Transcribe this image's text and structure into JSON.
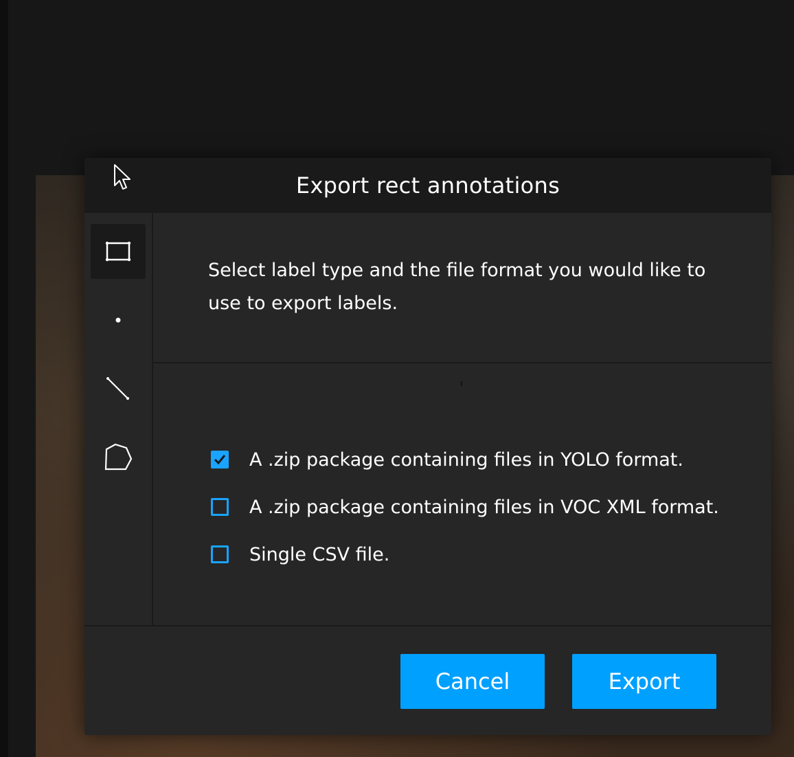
{
  "dialog": {
    "title": "Export rect annotations",
    "description": "Select label type and the file format you would like to use to export labels."
  },
  "sidebar": {
    "tools": [
      {
        "icon": "rectangle-icon",
        "active": true
      },
      {
        "icon": "point-icon",
        "active": false
      },
      {
        "icon": "line-icon",
        "active": false
      },
      {
        "icon": "polygon-icon",
        "active": false
      }
    ]
  },
  "options": [
    {
      "label": "A .zip package containing files in YOLO format.",
      "checked": true
    },
    {
      "label": "A .zip package containing files in VOC XML format.",
      "checked": false
    },
    {
      "label": "Single CSV file.",
      "checked": false
    }
  ],
  "footer": {
    "cancel_label": "Cancel",
    "export_label": "Export"
  },
  "colors": {
    "accent": "#00a0ff",
    "header_bg": "#1a1a1a",
    "panel_bg": "#262626"
  }
}
